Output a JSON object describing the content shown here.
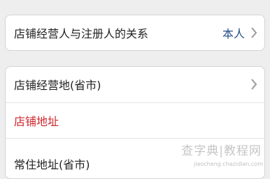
{
  "colors": {
    "background": "#eeeeee",
    "card": "#ffffff",
    "label": "#222222",
    "required_label": "#d0262c",
    "value": "#2c4f8a",
    "chevron": "#9a9a9a"
  },
  "relationship_section": {
    "label": "店铺经营人与注册人的关系",
    "value": "本人",
    "icon": "chevron-right-icon"
  },
  "address_section": {
    "rows": [
      {
        "label": "店铺经营地(省市)",
        "icon": "chevron-right-icon"
      },
      {
        "label": "店铺地址"
      },
      {
        "label": "常住地址(省市)"
      }
    ]
  },
  "watermark": {
    "title": "查字典|教程网",
    "url": "jiaocheng.chazidian.com"
  }
}
